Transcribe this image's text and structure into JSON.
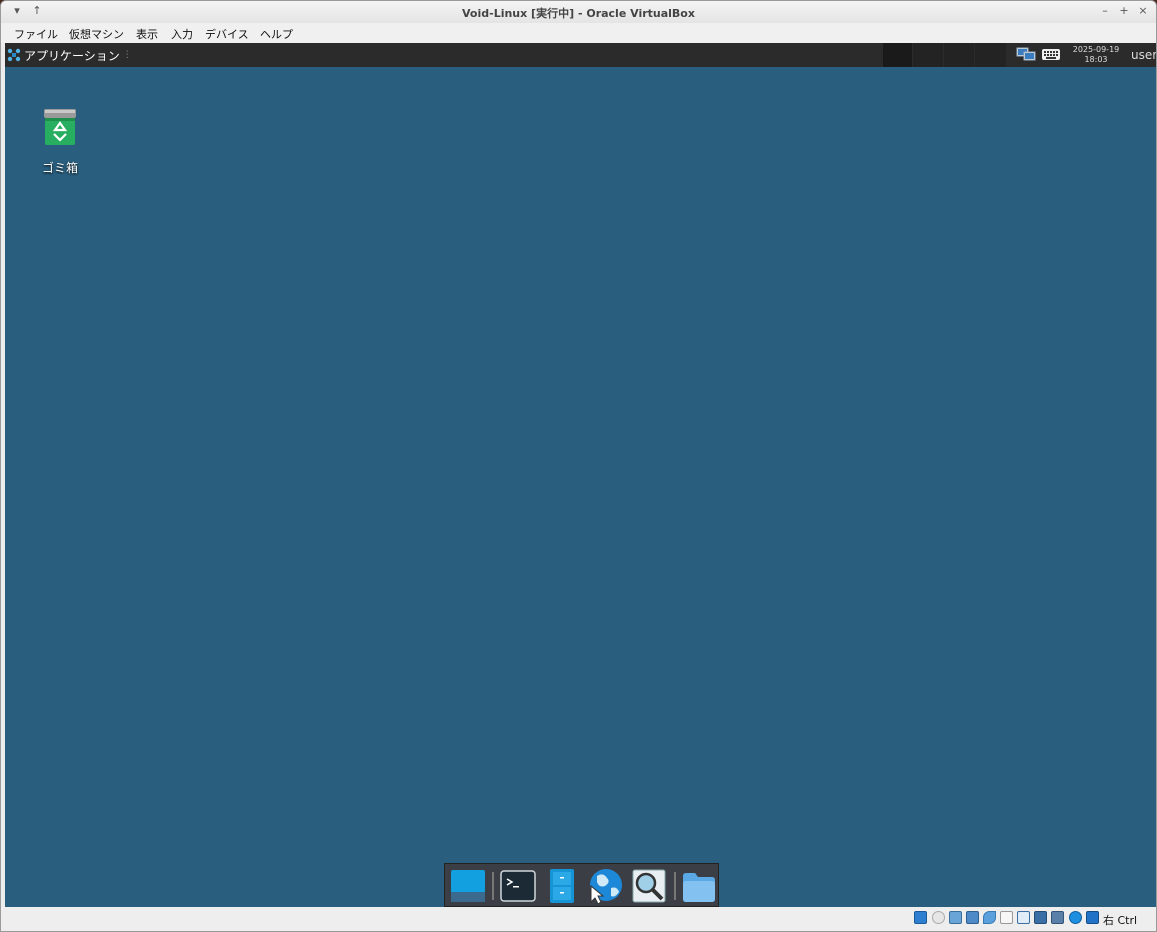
{
  "window": {
    "title": "Void-Linux [実行中] - Oracle VirtualBox",
    "controls": {
      "menu": "▾",
      "pin": "↑",
      "minimize": "–",
      "maximize": "+",
      "close": "×"
    }
  },
  "menubar": {
    "items": [
      "ファイル",
      "仮想マシン",
      "表示",
      "入力",
      "デバイス",
      "ヘルプ"
    ]
  },
  "guest": {
    "panel": {
      "app_menu_label": "アプリケーション",
      "app_menu_dots": "⋮",
      "clock_date": "2025-09-19",
      "clock_time": "18:03",
      "user": "user",
      "tray_icons": [
        "network-icon",
        "keyboard-icon"
      ]
    },
    "desktop": {
      "icons": [
        {
          "label": "ゴミ箱",
          "icon": "trash-icon"
        }
      ]
    },
    "dock": {
      "items": [
        "show-desktop-icon",
        "terminal-icon",
        "file-manager-icon",
        "web-browser-icon",
        "app-finder-icon",
        "folder-icon"
      ]
    },
    "background_color": "#295e7e"
  },
  "statusbar": {
    "host_key": "右 Ctrl",
    "icons": [
      "hard-disk-icon",
      "optical-drive-icon",
      "audio-icon",
      "network-icon",
      "usb-icon",
      "shared-folders-icon",
      "display-icon",
      "recording-icon",
      "virtualization-icon",
      "guest-additions-icon",
      "mouse-integration-icon",
      "keyboard-capture-icon"
    ]
  }
}
